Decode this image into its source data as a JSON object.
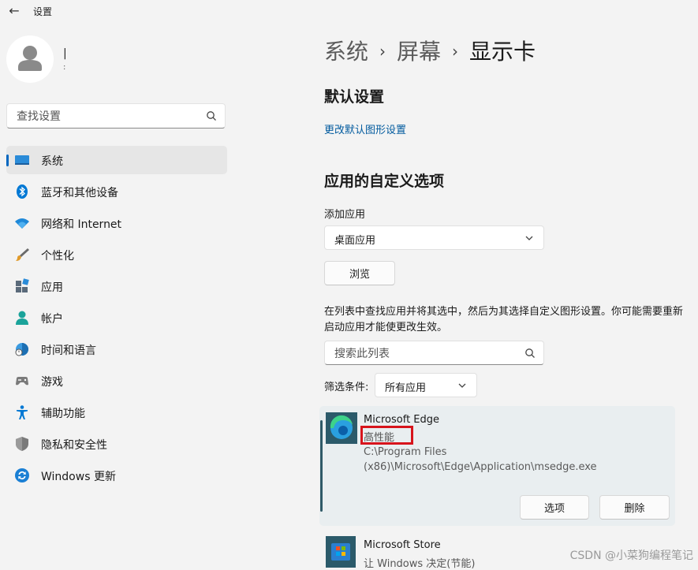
{
  "window": {
    "title": "设置",
    "back_glyph": "←"
  },
  "user": {
    "name": "|",
    "sub": ":"
  },
  "search": {
    "placeholder": "查找设置"
  },
  "nav": {
    "items": [
      {
        "label": "系统"
      },
      {
        "label": "蓝牙和其他设备"
      },
      {
        "label": "网络和 Internet"
      },
      {
        "label": "个性化"
      },
      {
        "label": "应用"
      },
      {
        "label": "帐户"
      },
      {
        "label": "时间和语言"
      },
      {
        "label": "游戏"
      },
      {
        "label": "辅助功能"
      },
      {
        "label": "隐私和安全性"
      },
      {
        "label": "Windows 更新"
      }
    ],
    "selected": "系统"
  },
  "breadcrumb": {
    "items": [
      "系统",
      "屏幕",
      "显示卡"
    ],
    "sep": "›"
  },
  "default_section": {
    "title": "默认设置",
    "link": "更改默认图形设置"
  },
  "custom_section": {
    "title": "应用的自定义选项",
    "add_label": "添加应用",
    "app_type_value": "桌面应用",
    "browse_label": "浏览",
    "description": "在列表中查找应用并将其选中，然后为其选择自定义图形设置。你可能需要重新启动应用才能使更改生效。",
    "list_search_placeholder": "搜索此列表",
    "filter_label": "筛选条件:",
    "filter_value": "所有应用"
  },
  "apps": [
    {
      "name": "Microsoft Edge",
      "preference": "高性能",
      "path": "C:\\Program Files (x86)\\Microsoft\\Edge\\Application\\msedge.exe",
      "options_label": "选项",
      "delete_label": "删除"
    },
    {
      "name": "Microsoft Store",
      "preference": "让 Windows 决定(节能)"
    }
  ],
  "colors": {
    "accent": "#0067c0",
    "highlight": "#d7141c",
    "card_bg": "#e9eef0"
  },
  "watermark": "CSDN @小菜狗编程笔记"
}
